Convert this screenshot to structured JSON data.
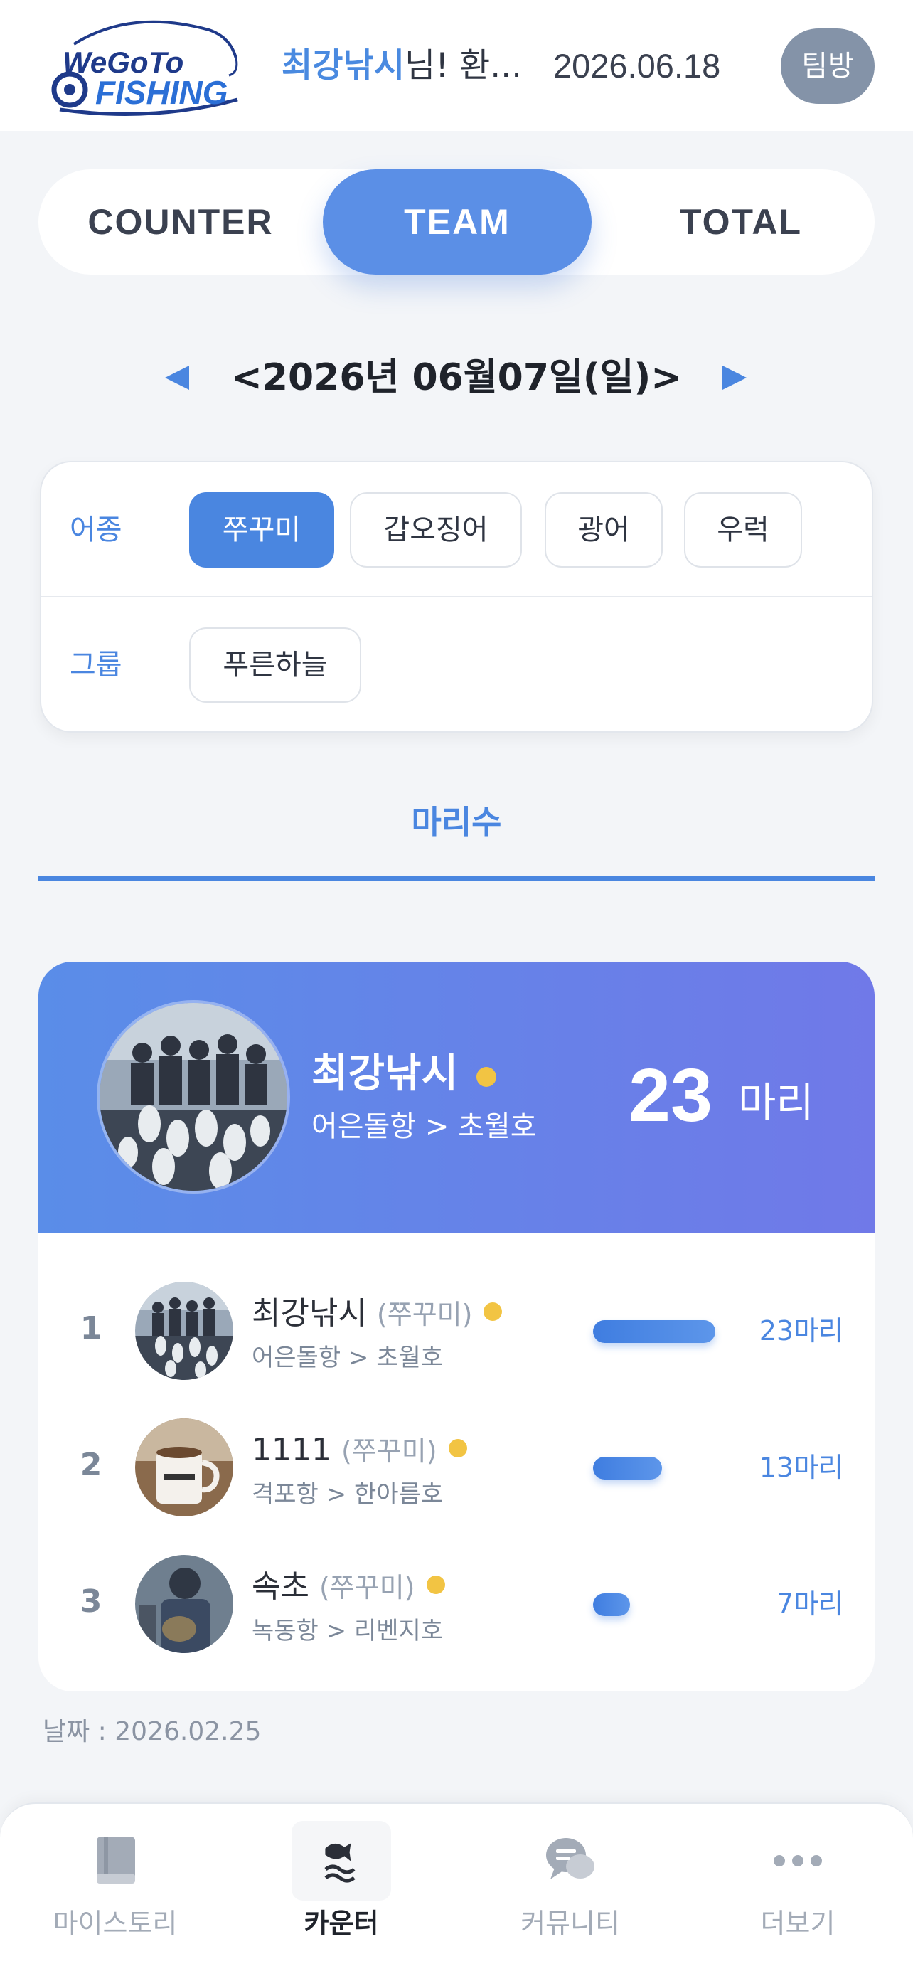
{
  "header": {
    "logo_line1": "WeGoTo",
    "logo_line2": "FISHING",
    "greeting_name": "최강낚시",
    "greeting_rest": "님! 환...",
    "date": "2026.06.18",
    "team_button": "팀방"
  },
  "segment": {
    "tabs": [
      "COUNTER",
      "TEAM",
      "TOTAL"
    ],
    "active": "TEAM"
  },
  "date_nav": {
    "label": "<2026년 06월07일(일)>"
  },
  "filter": {
    "species_label": "어종",
    "species": [
      "쭈꾸미",
      "갑오징어",
      "광어",
      "우럭"
    ],
    "species_active": "쭈꾸미",
    "group_label": "그룹",
    "groups": [
      "푸른하늘"
    ]
  },
  "count_tab": "마리수",
  "top": {
    "name": "최강낚시",
    "location": "어은돌항 > 초월호",
    "count": "23",
    "unit": "마리"
  },
  "ranking": [
    {
      "rank": "1",
      "name": "최강낚시",
      "species": "(쭈꾸미)",
      "location": "어은돌항 > 초월호",
      "count": "23마리",
      "value": 23
    },
    {
      "rank": "2",
      "name": "1111",
      "species": "(쭈꾸미)",
      "location": "격포항 > 한아름호",
      "count": "13마리",
      "value": 13
    },
    {
      "rank": "3",
      "name": "속초",
      "species": "(쭈꾸미)",
      "location": "녹동항 > 리벤지호",
      "count": "7마리",
      "value": 7
    }
  ],
  "footer_date": "날짜 : 2026.02.25",
  "bottom_nav": [
    {
      "label": "마이스토리",
      "icon": "book-icon"
    },
    {
      "label": "카운터",
      "icon": "fish-wave-icon",
      "active": true
    },
    {
      "label": "커뮤니티",
      "icon": "chat-bubbles-icon"
    },
    {
      "label": "더보기",
      "icon": "more-dots-icon"
    }
  ],
  "colors": {
    "accent": "#4a86e0",
    "hero_gradient_start": "#5a8de8",
    "hero_gradient_end": "#7079e8",
    "online_dot": "#f2c443",
    "team_button": "#8493a8"
  }
}
